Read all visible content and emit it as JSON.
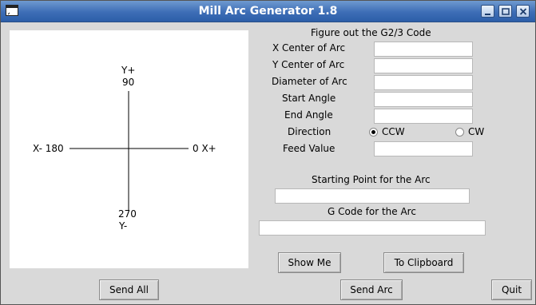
{
  "window": {
    "title": "Mill Arc Generator 1.8"
  },
  "canvas": {
    "y_plus": "Y+",
    "y_plus_angle": "90",
    "x_minus": "X- 180",
    "x_plus": "0 X+",
    "y_minus_angle": "270",
    "y_minus": "Y-"
  },
  "form": {
    "heading": "Figure out the G2/3 Code",
    "x_center_label": "X Center of Arc",
    "x_center_value": "",
    "y_center_label": "Y Center of Arc",
    "y_center_value": "",
    "diameter_label": "Diameter of Arc",
    "diameter_value": "",
    "start_angle_label": "Start Angle",
    "start_angle_value": "",
    "end_angle_label": "End Angle",
    "end_angle_value": "",
    "direction_label": "Direction",
    "ccw_label": "CCW",
    "cw_label": "CW",
    "direction_selected": "CCW",
    "feed_label": "Feed Value",
    "feed_value": "",
    "starting_point_label": "Starting Point for the Arc",
    "starting_point_value": "",
    "gcode_label": "G Code for the Arc",
    "gcode_value": ""
  },
  "buttons": {
    "show_me": "Show Me",
    "to_clipboard": "To Clipboard",
    "send_all": "Send All",
    "send_arc": "Send Arc",
    "quit": "Quit"
  },
  "icons": {
    "window": "window-icon",
    "minimize": "minimize-icon",
    "maximize": "maximize-icon",
    "close": "close-icon"
  }
}
